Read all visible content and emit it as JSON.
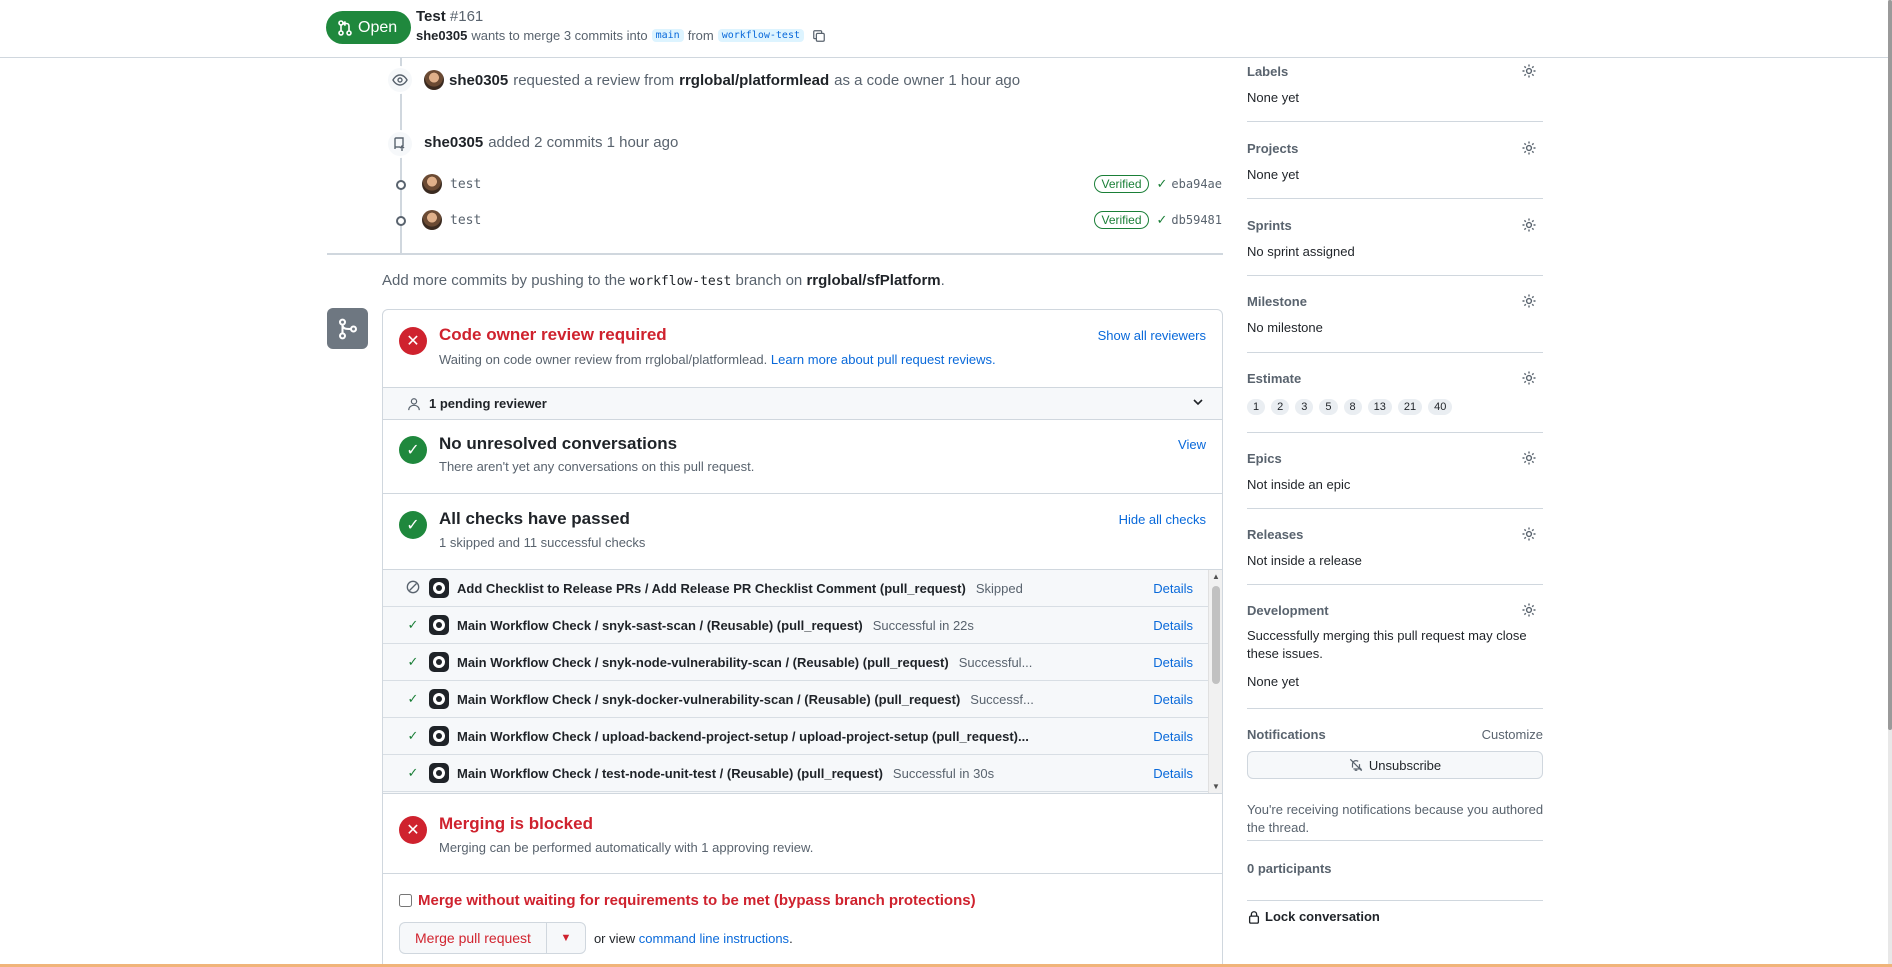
{
  "header": {
    "state": "Open",
    "title": "Test",
    "number": "#161",
    "author": "she0305",
    "merge_text": "wants to merge 3 commits into",
    "base_branch": "main",
    "from_text": "from",
    "head_branch": "workflow-test"
  },
  "timeline": {
    "review_event": {
      "actor": "she0305",
      "text_pre": "requested a review from",
      "team": "rrglobal/platformlead",
      "text_post": "as a code owner 1 hour ago"
    },
    "commits_event": {
      "actor": "she0305",
      "text": "added 2 commits 1 hour ago"
    },
    "commits": [
      {
        "message": "test",
        "badge": "Verified",
        "sha": "eba94ae"
      },
      {
        "message": "test",
        "badge": "Verified",
        "sha": "db59481"
      }
    ],
    "push_hint": {
      "prefix": "Add more commits by pushing to the",
      "branch": "workflow-test",
      "middle": "branch on",
      "repo": "rrglobal/sfPlatform",
      "suffix": "."
    }
  },
  "merge_box": {
    "code_owner": {
      "title": "Code owner review required",
      "desc": "Waiting on code owner review from rrglobal/platformlead.",
      "learn_more": "Learn more about pull request reviews.",
      "action": "Show all reviewers"
    },
    "pending": "1 pending reviewer",
    "conversations": {
      "title": "No unresolved conversations",
      "desc": "There aren't yet any conversations on this pull request.",
      "action": "View"
    },
    "checks": {
      "title": "All checks have passed",
      "desc": "1 skipped and 11 successful checks",
      "action": "Hide all checks",
      "details_label": "Details",
      "items": [
        {
          "state": "skipped",
          "name": "Add Checklist to Release PRs / Add Release PR Checklist Comment (pull_request)",
          "status": "Skipped"
        },
        {
          "state": "success",
          "name": "Main Workflow Check / snyk-sast-scan / (Reusable) (pull_request)",
          "status": "Successful in 22s"
        },
        {
          "state": "success",
          "name": "Main Workflow Check / snyk-node-vulnerability-scan / (Reusable) (pull_request)",
          "status": "Successful..."
        },
        {
          "state": "success",
          "name": "Main Workflow Check / snyk-docker-vulnerability-scan / (Reusable) (pull_request)",
          "status": "Successf..."
        },
        {
          "state": "success",
          "name": "Main Workflow Check / upload-backend-project-setup / upload-project-setup (pull_request)...",
          "status": ""
        },
        {
          "state": "success",
          "name": "Main Workflow Check / test-node-unit-test / (Reusable) (pull_request)",
          "status": "Successful in 30s"
        }
      ]
    },
    "blocked": {
      "title": "Merging is blocked",
      "desc": "Merging can be performed automatically with 1 approving review."
    },
    "bypass_label": "Merge without waiting for requirements to be met (bypass branch protections)",
    "merge_button": "Merge pull request",
    "cmd_prefix": "or view",
    "cmd_link": "command line instructions",
    "cmd_suffix": "."
  },
  "sidebar": {
    "labels": {
      "head": "Labels",
      "value": "None yet"
    },
    "projects": {
      "head": "Projects",
      "value": "None yet"
    },
    "sprints": {
      "head": "Sprints",
      "value": "No sprint assigned"
    },
    "milestone": {
      "head": "Milestone",
      "value": "No milestone"
    },
    "estimate": {
      "head": "Estimate",
      "values": [
        "1",
        "2",
        "3",
        "5",
        "8",
        "13",
        "21",
        "40"
      ]
    },
    "epics": {
      "head": "Epics",
      "value": "Not inside an epic"
    },
    "releases": {
      "head": "Releases",
      "value": "Not inside a release"
    },
    "development": {
      "head": "Development",
      "desc_line1": "Successfully merging this pull request may close",
      "desc_line2": "these issues.",
      "value": "None yet"
    },
    "notifications": {
      "head": "Notifications",
      "customize": "Customize",
      "button": "Unsubscribe",
      "reason_line1": "You're receiving notifications because you authored",
      "reason_line2": "the thread."
    },
    "participants": "0 participants",
    "lock": "Lock conversation"
  },
  "colors": {
    "open_green": "#1f883d",
    "danger_red": "#cf222e",
    "link_blue": "#0969da",
    "muted": "#59636e"
  }
}
